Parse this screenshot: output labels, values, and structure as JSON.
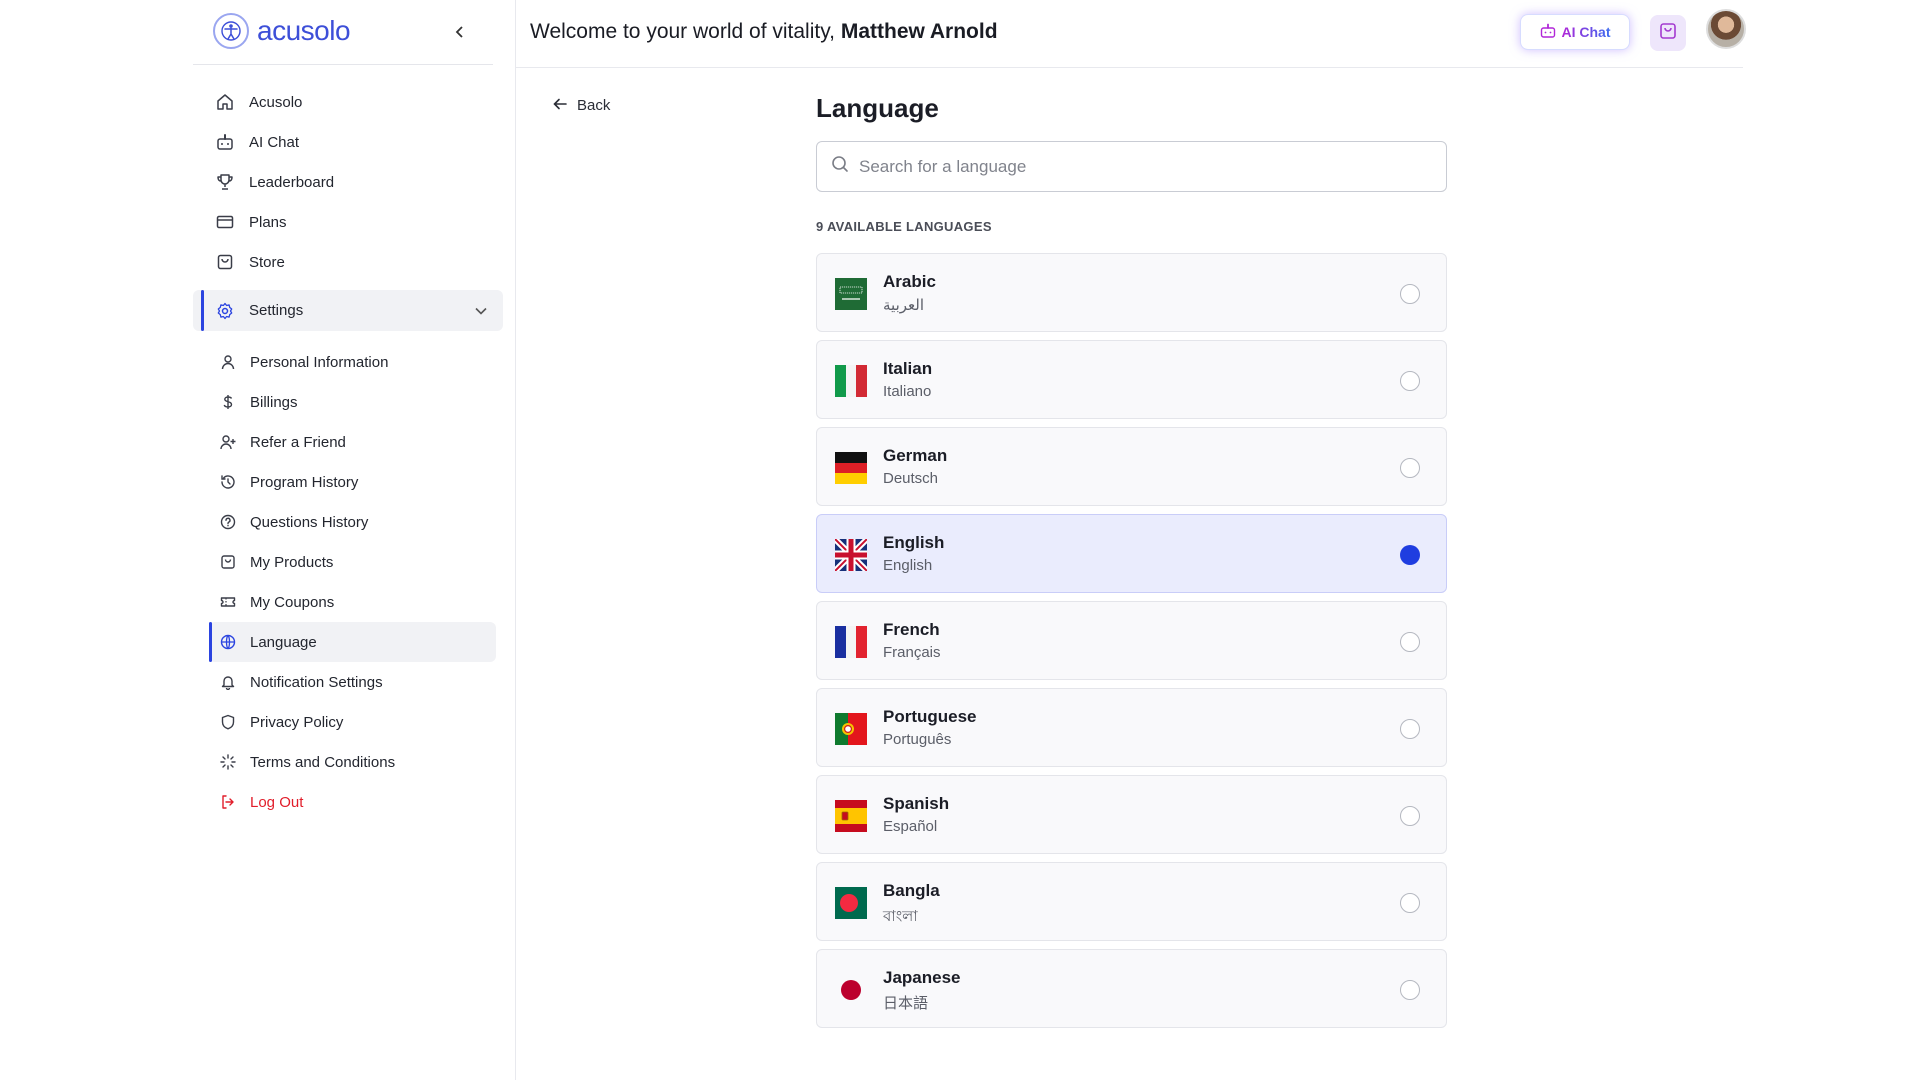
{
  "brand": {
    "name": "acusolo"
  },
  "header": {
    "welcome_prefix": "Welcome to your world of vitality, ",
    "user_name": "Matthew Arnold",
    "ai_chat_label": "AI Chat"
  },
  "sidebar": {
    "items": [
      {
        "label": "Acusolo",
        "icon": "home-icon"
      },
      {
        "label": "AI Chat",
        "icon": "robot-icon"
      },
      {
        "label": "Leaderboard",
        "icon": "trophy-icon"
      },
      {
        "label": "Plans",
        "icon": "card-icon"
      },
      {
        "label": "Store",
        "icon": "bag-icon"
      }
    ],
    "settings_label": "Settings",
    "settings_items": [
      {
        "label": "Personal Information",
        "icon": "user-icon"
      },
      {
        "label": "Billings",
        "icon": "dollar-icon"
      },
      {
        "label": "Refer a Friend",
        "icon": "user-plus-icon"
      },
      {
        "label": "Program History",
        "icon": "history-icon"
      },
      {
        "label": "Questions History",
        "icon": "question-icon"
      },
      {
        "label": "My Products",
        "icon": "bag-icon"
      },
      {
        "label": "My Coupons",
        "icon": "ticket-icon"
      },
      {
        "label": "Language",
        "icon": "globe-icon"
      },
      {
        "label": "Notification Settings",
        "icon": "bell-icon"
      },
      {
        "label": "Privacy Policy",
        "icon": "shield-icon"
      },
      {
        "label": "Terms and Conditions",
        "icon": "sparkle-icon"
      },
      {
        "label": "Log Out",
        "icon": "logout-icon"
      }
    ]
  },
  "main": {
    "back_label": "Back",
    "title": "Language",
    "search_placeholder": "Search for a language",
    "count_label": "9 AVAILABLE LANGUAGES",
    "languages": [
      {
        "name": "Arabic",
        "native": "العربية",
        "flag": "saudi-arabia",
        "selected": false
      },
      {
        "name": "Italian",
        "native": "Italiano",
        "flag": "italy",
        "selected": false
      },
      {
        "name": "German",
        "native": "Deutsch",
        "flag": "germany",
        "selected": false
      },
      {
        "name": "English",
        "native": "English",
        "flag": "united-kingdom",
        "selected": true
      },
      {
        "name": "French",
        "native": "Français",
        "flag": "france",
        "selected": false
      },
      {
        "name": "Portuguese",
        "native": "Português",
        "flag": "portugal",
        "selected": false
      },
      {
        "name": "Spanish",
        "native": "Español",
        "flag": "spain",
        "selected": false
      },
      {
        "name": "Bangla",
        "native": "বাংলা",
        "flag": "bangladesh",
        "selected": false
      },
      {
        "name": "Japanese",
        "native": "日本語",
        "flag": "japan",
        "selected": false
      }
    ]
  },
  "colors": {
    "accent": "#1f3de0",
    "selected_bg": "#eaecfd",
    "logout": "#e11d2a"
  }
}
